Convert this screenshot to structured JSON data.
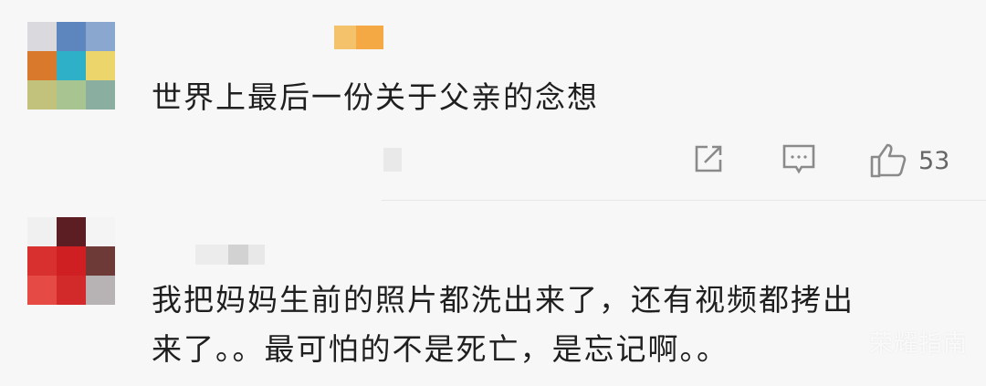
{
  "comments": [
    {
      "text": "世界上最后一份关于父亲的念想",
      "actions": {
        "share_icon": "share-square-icon",
        "reply_icon": "comment-bubble-icon",
        "like_icon": "thumbs-up-icon",
        "like_count": "53"
      }
    },
    {
      "text_line1": "我把妈妈生前的照片都洗出来了，还有视频都拷出",
      "text_line2": "来了。。最可怕的不是死亡，是忘记啊。。"
    }
  ],
  "watermark": "荣耀指南",
  "colors": {
    "background": "#f7f7f7",
    "icon": "#8a8a8a",
    "text": "#1f1f1f",
    "count": "#666666"
  }
}
